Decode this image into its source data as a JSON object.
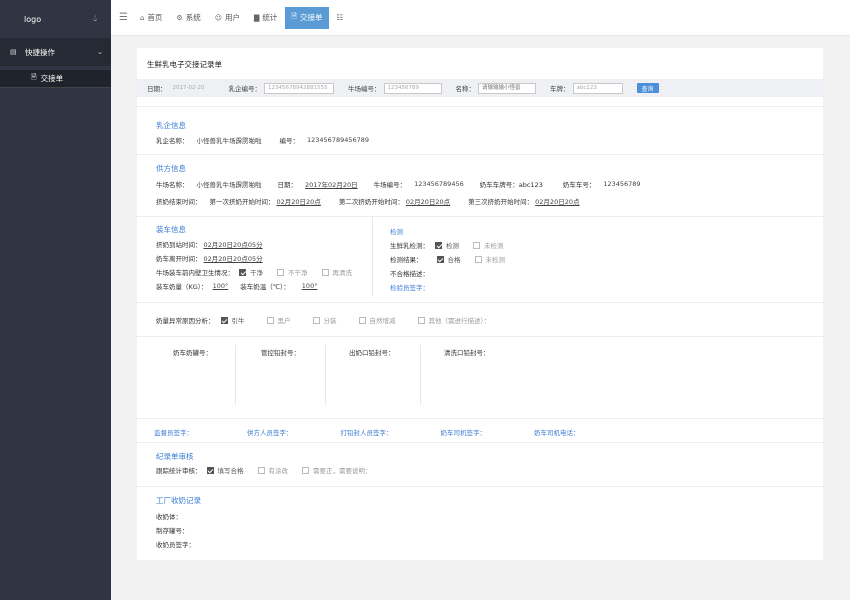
{
  "sidebar": {
    "logo": "logo",
    "group_label": "快捷操作",
    "sub_item": "交接单"
  },
  "topbar": {
    "items": [
      {
        "label": "首页",
        "icon": "home-icon"
      },
      {
        "label": "系统",
        "icon": "gear-icon"
      },
      {
        "label": "用户",
        "icon": "user-icon"
      },
      {
        "label": "统计",
        "icon": "bar-chart-icon"
      },
      {
        "label": "交接单",
        "icon": "document-icon",
        "active": true
      }
    ]
  },
  "form": {
    "title": "生鲜乳电子交接记录单",
    "filter": {
      "date_label": "日期：",
      "date_value": "2017-02-20",
      "dairy_no_label": "乳企编号：",
      "dairy_no_value": "12345678942881555",
      "farm_no_label": "牛场编号：",
      "farm_no_value": "123456789",
      "name_label": "名称：",
      "name_placeholder": "请输输输小怪兽",
      "plate_label": "车牌：",
      "plate_value": "abc123",
      "query_button": "查询"
    },
    "dairy": {
      "title": "乳企信息",
      "name_label": "乳企名称：",
      "name_value": "小怪兽乳牛场霹雳啪啦",
      "no_label": "编号：",
      "no_value": "123456789456789"
    },
    "supplier": {
      "title": "供方信息",
      "farm_name_label": "牛场名称：",
      "farm_name_value": "小怪兽乳牛场霹雳啪啦",
      "date_label": "日期：",
      "date_value": "2017年02月20日",
      "farm_no_label": "牛场编号：",
      "farm_no_value": "123456789456",
      "plate_label": "奶车车牌号：abc123",
      "truck_no_label": "奶车车号：",
      "truck_no_value": "123456789",
      "milk_end_label": "挤奶结束时间：",
      "first_label": "第一次挤奶开始时间：",
      "first_value": "02月20日20点",
      "second_label": "第二次挤奶开始时间：",
      "second_value": "02月20日20点",
      "third_label": "第三次挤奶开始时间：",
      "third_value": "02月20日20点"
    },
    "loading": {
      "title": "装车信息",
      "arrive_label": "挤奶到站时间：",
      "arrive_value": "02月20日20点05分",
      "leave_label": "奶车离开时间：",
      "leave_value": "02月20日20点05分",
      "hygiene_label": "牛场装车前内壁卫生情况：",
      "hygiene_options": [
        {
          "label": "干净",
          "checked": true
        },
        {
          "label": "不干净",
          "checked": false
        },
        {
          "label": "再清洗",
          "checked": false
        }
      ],
      "weight_label": "装车奶量（KG）：",
      "weight_value": "100°",
      "temp_label": "装车奶温（℃）：",
      "temp_value": "100°"
    },
    "inspection": {
      "title": "检测",
      "fresh_label": "生鲜乳检测：",
      "fresh_options": [
        {
          "label": "检测",
          "checked": true
        },
        {
          "label": "未检测",
          "checked": false
        }
      ],
      "result_label": "检测结果：",
      "result_options": [
        {
          "label": "合格",
          "checked": true
        },
        {
          "label": "未检测",
          "checked": false
        }
      ],
      "unqualified_label": "不合格描述：",
      "inspector_label": "检验员签字："
    },
    "abnormal": {
      "label": "奶量异常原因分析：",
      "options": [
        {
          "label": "引牛",
          "checked": true
        },
        {
          "label": "黑户",
          "checked": false
        },
        {
          "label": "分装",
          "checked": false
        },
        {
          "label": "自然增减",
          "checked": false
        },
        {
          "label": "其他（需进行描述）：",
          "checked": false
        }
      ]
    },
    "seals": {
      "cols": [
        "奶车奶罐号：",
        "管控铅封号：",
        "出奶口铅封号：",
        "清洗口铅封号："
      ]
    },
    "signatures": [
      "监督员签字：",
      "供方人员签字：",
      "打铅封人员签字：",
      "奶车司机签字：",
      "奶车司机电话："
    ],
    "review": {
      "title": "纪录单审核",
      "label": "跟踪统计审核：",
      "options": [
        {
          "label": "填写合格",
          "checked": true
        },
        {
          "label": "有涂改",
          "checked": false
        },
        {
          "label": "需要正，需要说明：",
          "checked": false
        }
      ]
    },
    "factory": {
      "title": "工厂收奶记录",
      "receiver": "收奶体：",
      "tank": "制存罐号：",
      "signer": "收奶员签字："
    }
  }
}
